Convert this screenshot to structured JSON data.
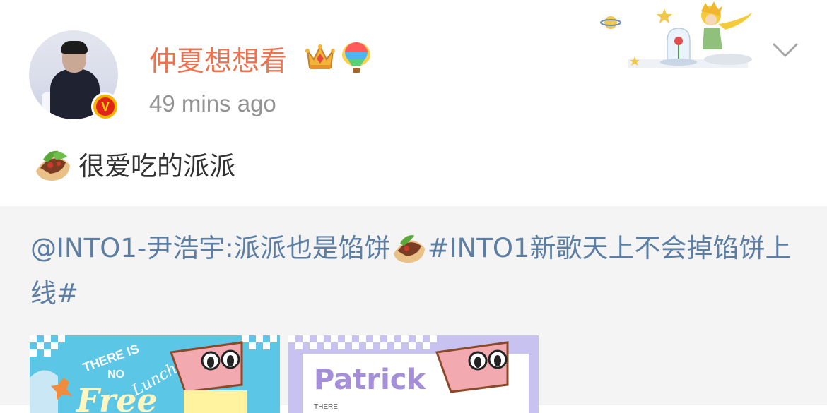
{
  "post": {
    "username": "仲夏想想看",
    "timestamp": "49 mins ago",
    "verified_badge": "V",
    "text": "很爱吃的派派",
    "emoji": "taco-icon"
  },
  "repost": {
    "mention": "@INTO1-尹浩宇",
    "text": ":派派也是馅饼",
    "hashtag": "#INTO1新歌天上不会掉馅饼上线#"
  },
  "thumbnails": {
    "t1_line1": "THERE IS",
    "t1_line2": "NO",
    "t1_line3": "Free",
    "t1_line4": "Lunch",
    "t2_title": "Patrick",
    "t2_small": "THERE"
  },
  "colors": {
    "username": "#eb7350",
    "timestamp": "#939393",
    "link": "#5d7ea3",
    "repost_bg": "#f4f4f4"
  }
}
